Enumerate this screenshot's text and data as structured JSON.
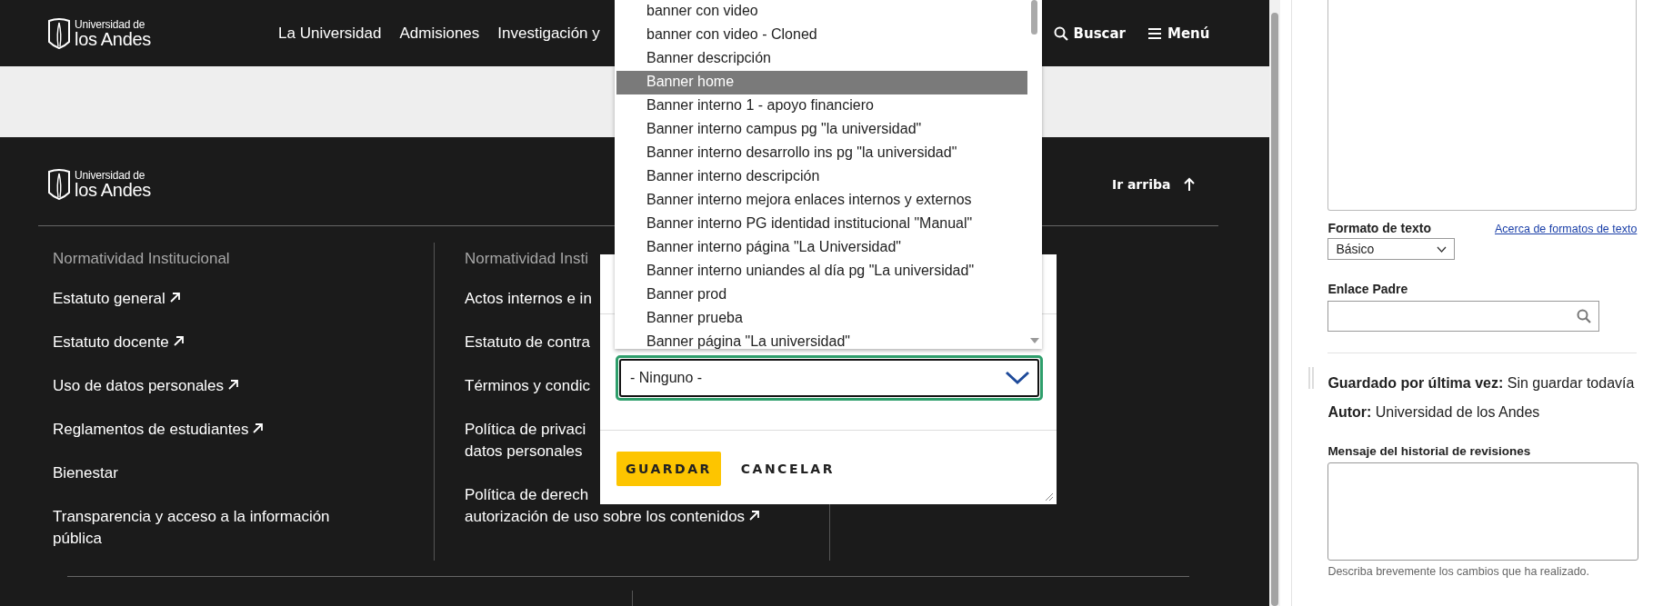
{
  "header": {
    "logo": {
      "line1": "Universidad de",
      "line2": "los Andes"
    },
    "nav": [
      "La Universidad",
      "Admisiones",
      "Investigación y"
    ],
    "actions": [
      {
        "kind": "search",
        "label": "Buscar"
      },
      {
        "kind": "menu",
        "label": "Menú"
      }
    ]
  },
  "footer": {
    "logo": {
      "line1": "Universidad de",
      "line2": "los Andes"
    },
    "back_to_top": "Ir arriba",
    "columns": [
      {
        "heading": "Normatividad Institucional",
        "links": [
          {
            "text": "Estatuto general",
            "external": true
          },
          {
            "text": "Estatuto docente",
            "external": true
          },
          {
            "text": "Uso de datos personales",
            "external": true
          },
          {
            "text": "Reglamentos de estudiantes",
            "external": true
          },
          {
            "text": "Bienestar",
            "external": false
          },
          {
            "text": "Transparencia y acceso a la información pública",
            "external": false
          }
        ]
      },
      {
        "heading": "Normatividad Insti",
        "links": [
          {
            "text": "Actos internos e in",
            "external": false
          },
          {
            "text": "Estatuto de contra",
            "external": false
          },
          {
            "text": "Términos y condic",
            "external": false
          },
          {
            "text": "Política de privaci\ndatos personales",
            "external": false
          },
          {
            "text": "Política de derech\nautorización de uso sobre los contenidos",
            "external": true
          }
        ]
      }
    ]
  },
  "modal": {
    "dropdown": {
      "options": [
        {
          "label": "banner con video",
          "selected": false
        },
        {
          "label": "banner con video - Cloned",
          "selected": false
        },
        {
          "label": "Banner descripción",
          "selected": false
        },
        {
          "label": "Banner home",
          "selected": true
        },
        {
          "label": "Banner interno 1 - apoyo financiero",
          "selected": false
        },
        {
          "label": "Banner interno campus pg \"la universidad\"",
          "selected": false
        },
        {
          "label": "Banner interno desarrollo ins pg \"la universidad\"",
          "selected": false
        },
        {
          "label": "Banner interno descripción",
          "selected": false
        },
        {
          "label": "Banner interno mejora enlaces internos y externos",
          "selected": false
        },
        {
          "label": "Banner interno PG identidad institucional \"Manual\"",
          "selected": false
        },
        {
          "label": "Banner interno página \"La Universidad\"",
          "selected": false
        },
        {
          "label": "Banner interno uniandes al día pg \"La universidad\"",
          "selected": false
        },
        {
          "label": "Banner prod",
          "selected": false
        },
        {
          "label": "Banner prueba",
          "selected": false
        },
        {
          "label": "Banner página \"La universidad\"",
          "selected": false
        }
      ]
    },
    "select": {
      "value": "- Ninguno -"
    },
    "buttons": [
      {
        "kind": "primary",
        "label": "GUARDAR"
      },
      {
        "kind": "secondary",
        "label": "CANCELAR"
      }
    ]
  },
  "sidebar": {
    "text_format": {
      "label": "Formato de texto",
      "help_link": "Acerca de formatos de texto",
      "value": "Básico"
    },
    "parent_link": {
      "label": "Enlace Padre"
    },
    "meta": [
      "**Guardado por última vez:** Sin guardar todavía",
      "**Autor:** Universidad de los Andes"
    ],
    "revision": {
      "label": "Mensaje del historial de revisiones",
      "help": "Describa brevemente los cambios que ha realizado."
    }
  }
}
